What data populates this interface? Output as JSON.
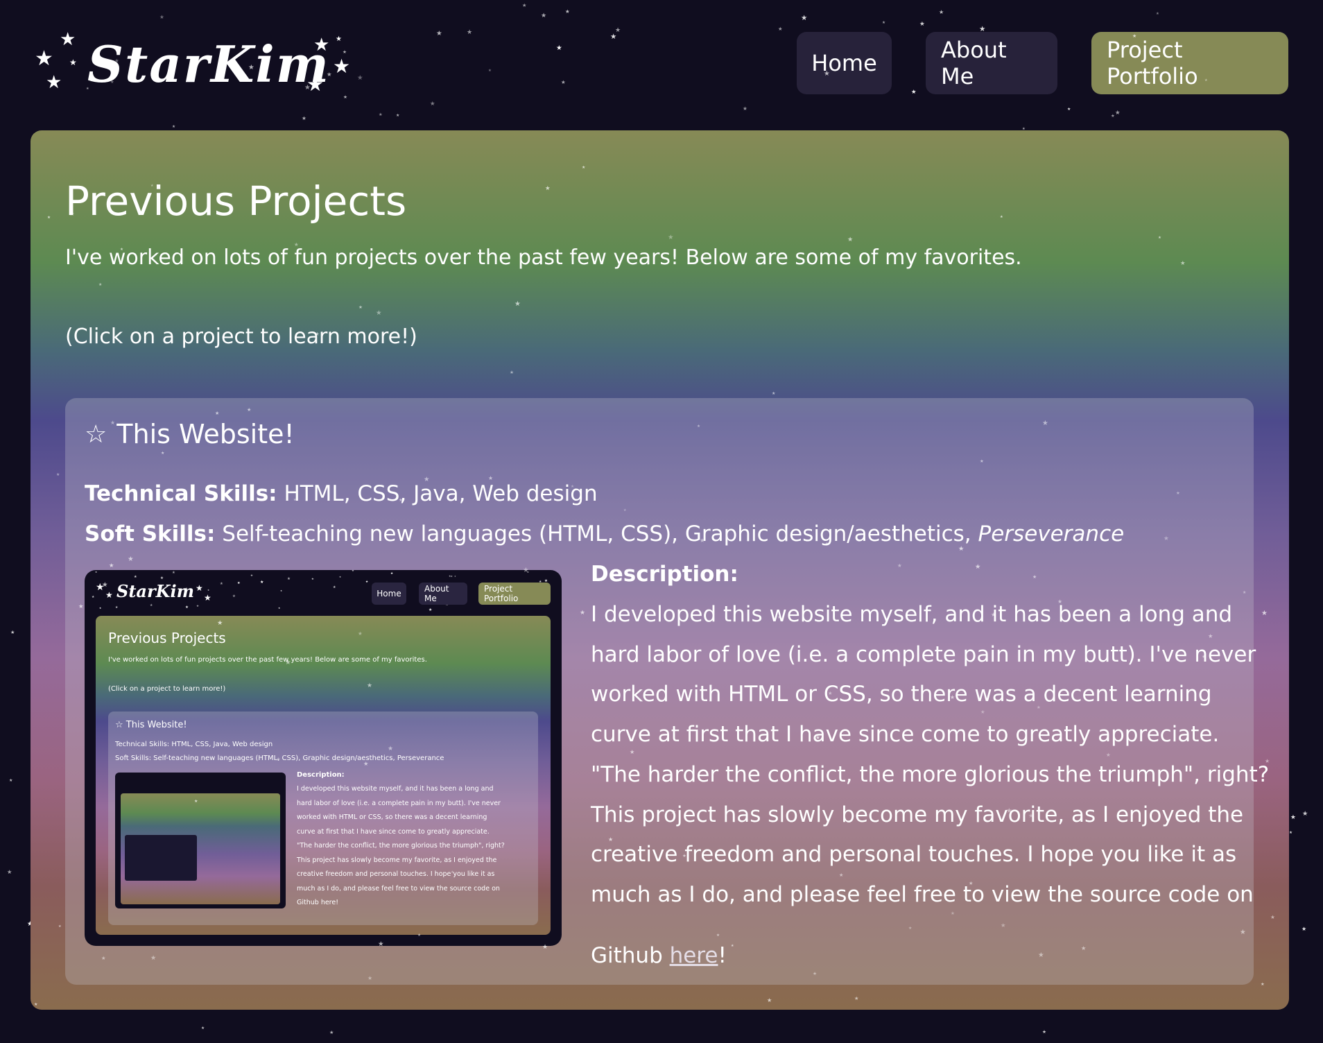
{
  "header": {
    "logo_text": "StarKim",
    "nav": [
      {
        "label": "Home"
      },
      {
        "label": "About Me"
      },
      {
        "label": "Project Portfolio",
        "active": true
      }
    ]
  },
  "main": {
    "title": "Previous Projects",
    "intro": "I've worked on lots of fun projects over the past few years! Below are some of my favorites.",
    "click_hint": "(Click on a project to learn more!)",
    "project": {
      "icon": "star-outline-icon",
      "title": "This Website!",
      "technical_label": "Technical Skills:",
      "technical_value": "HTML, CSS, Java, Web design",
      "soft_label": "Soft Skills:",
      "soft_value": "Self-teaching new languages (HTML, CSS), Graphic design/aesthetics,",
      "soft_value_italic": "Perseverance",
      "description_heading": "Description:",
      "description_lines": [
        "I developed this website myself, and it has been a long and",
        "hard labor of love (i.e. a complete pain in my butt). I've never",
        "worked with HTML or CSS, so there was a decent learning",
        "curve at first that I have since come to greatly appreciate.",
        "\"The harder the conflict, the more glorious the triumph\", right?",
        "This project has slowly become my favorite, as I enjoyed the",
        "creative freedom and personal touches. I hope you like it as",
        "much as I do, and please feel free to view the source code on"
      ],
      "description_last_prefix": "Github ",
      "description_link": "here",
      "description_last_suffix": "!",
      "preview": {
        "logo_text": "StarKim",
        "nav": [
          "Home",
          "About Me",
          "Project Portfolio"
        ],
        "title": "Previous Projects",
        "intro": "I've worked on lots of fun projects over the past few years! Below are some of my favorites.",
        "click_hint": "(Click on a project to learn more!)",
        "card_title": "This Website!",
        "technical": "Technical Skills: HTML, CSS, Java, Web design",
        "soft": "Soft Skills: Self-teaching new languages (HTML, CSS), Graphic design/aesthetics, Perseverance",
        "desc_heading": "Description:",
        "desc_lines": [
          "I developed this website myself, and it has been a long and",
          "hard labor of love (i.e. a complete pain in my butt). I've never",
          "worked with HTML or CSS, so there was a decent learning",
          "curve at first that I have since come to greatly appreciate.",
          "\"The harder the conflict, the more glorious the triumph\", right?",
          "This project has slowly become my favorite, as I enjoyed the",
          "creative freedom and personal touches. I hope you like it as",
          "much as I do, and please feel free to view the source code on",
          "Github here!"
        ]
      }
    }
  },
  "colors": {
    "background": "#100d1f",
    "nav_button": "#27223a",
    "nav_active": "#868a56"
  }
}
